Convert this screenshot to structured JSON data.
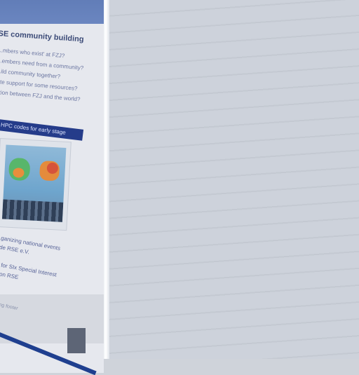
{
  "poster": {
    "section_title": "SE community building",
    "bullets": [
      "...mbers who exist' at FZJ?",
      "...embers need from a community?",
      "...ild community together?",
      "...te support for some resources?",
      "...tion between FZJ and the world?"
    ],
    "blue_bar_label": "HPC codes for early stage",
    "lower_text": [
      "...ganizing national events",
      "...de RSE e.V.",
      "",
      "...d for SIx Special Interest",
      "...p on RSE"
    ],
    "footer_label": "...ing footer"
  },
  "colors": {
    "header_blue": "#5f7bb6",
    "bar_blue": "#253c8a",
    "wall_gray": "#cdd2db"
  }
}
